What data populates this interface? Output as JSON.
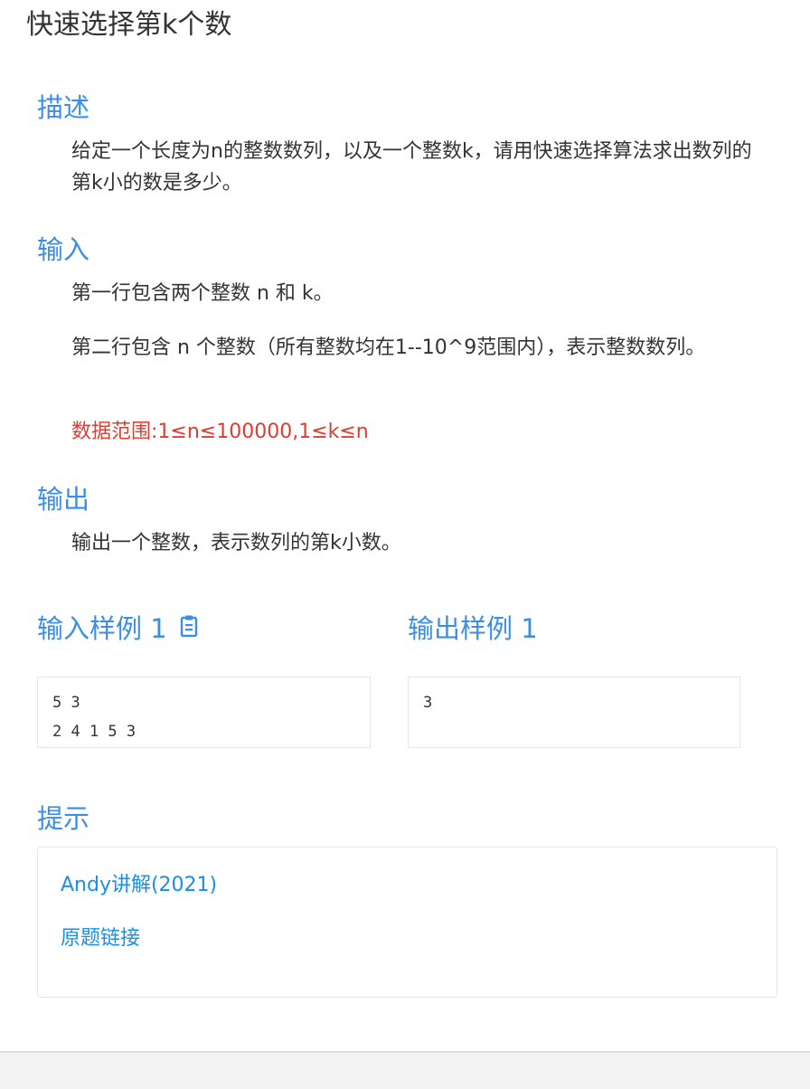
{
  "page": {
    "title": "快速选择第k个数"
  },
  "description": {
    "heading": "描述",
    "text": "给定一个长度为n的整数数列，以及一个整数k，请用快速选择算法求出数列的第k小的数是多少。"
  },
  "input": {
    "heading": "输入",
    "line1": "第一行包含两个整数 n 和 k。",
    "line2": "第二行包含 n 个整数（所有整数均在1--10^9范围内），表示整数数列。",
    "range": "数据范围:1≤n≤100000,1≤k≤n"
  },
  "output": {
    "heading": "输出",
    "text": "输出一个整数，表示数列的第k小数。"
  },
  "samples": {
    "input_heading": "输入样例 1",
    "output_heading": "输出样例 1",
    "input_value": "5 3\n2 4 1 5 3",
    "output_value": "3",
    "copy_icon": "clipboard-icon"
  },
  "hint": {
    "heading": "提示",
    "links": [
      "Andy讲解(2021)",
      "原题链接"
    ]
  },
  "colors": {
    "heading_blue": "#3a8ee6",
    "link_blue": "#1a8fe3",
    "range_red": "#e03c31",
    "text": "#333333"
  }
}
